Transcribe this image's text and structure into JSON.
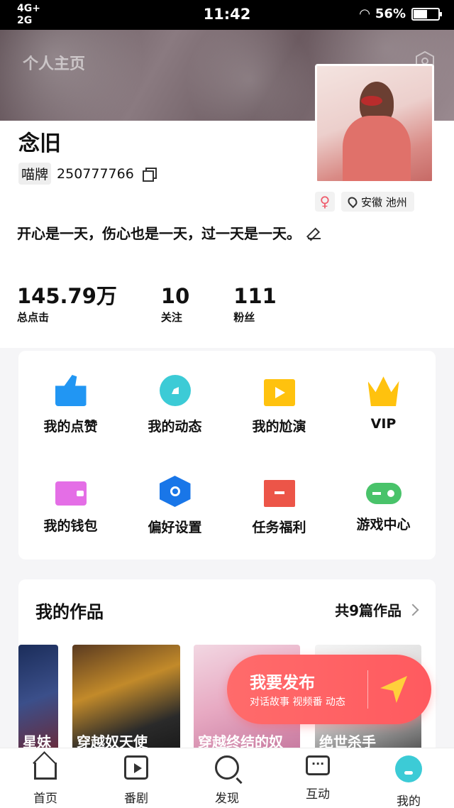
{
  "status_bar": {
    "network_1": "4G+",
    "network_2": "2G",
    "time": "11:42",
    "battery_percent": "56%",
    "battery_level": 0.56
  },
  "header": {
    "title": "个人主页"
  },
  "profile": {
    "username": "念旧",
    "id_badge": "喵牌",
    "id_number": "250777766",
    "gender_symbol": "♀",
    "location": "安徽 池州",
    "bio": "开心是一天，伤心也是一天，过一天是一天。"
  },
  "stats": [
    {
      "value": "145.79万",
      "label": "总点击"
    },
    {
      "value": "10",
      "label": "关注"
    },
    {
      "value": "111",
      "label": "粉丝"
    }
  ],
  "menu": [
    {
      "label": "我的点赞",
      "icon": "thumb-up-icon",
      "color": "#2196f3"
    },
    {
      "label": "我的动态",
      "icon": "compass-icon",
      "color": "#3ccbd6"
    },
    {
      "label": "我的尬演",
      "icon": "video-clap-icon",
      "color": "#ffc20e"
    },
    {
      "label": "VIP",
      "icon": "crown-icon",
      "color": "#ffc20e"
    },
    {
      "label": "我的钱包",
      "icon": "wallet-icon",
      "color": "#e46ee6"
    },
    {
      "label": "偏好设置",
      "icon": "hex-settings-icon",
      "color": "#1976e8"
    },
    {
      "label": "任务福利",
      "icon": "task-box-icon",
      "color": "#ec5548"
    },
    {
      "label": "游戏中心",
      "icon": "gamepad-icon",
      "color": "#49c36a"
    }
  ],
  "works": {
    "title": "我的作品",
    "count_text": "共9篇作品",
    "items": [
      {
        "title": "星妹"
      },
      {
        "title": "穿越奴天使"
      },
      {
        "title": "穿越终结的奴"
      },
      {
        "title": "绝世杀手"
      }
    ]
  },
  "publish": {
    "title": "我要发布",
    "subtitle": "对话故事 视频番 动态"
  },
  "tabbar": [
    {
      "label": "首页",
      "icon": "home-icon"
    },
    {
      "label": "番剧",
      "icon": "play-icon"
    },
    {
      "label": "发现",
      "icon": "discover-icon"
    },
    {
      "label": "互动",
      "icon": "chat-icon"
    },
    {
      "label": "我的",
      "icon": "profile-icon"
    }
  ]
}
